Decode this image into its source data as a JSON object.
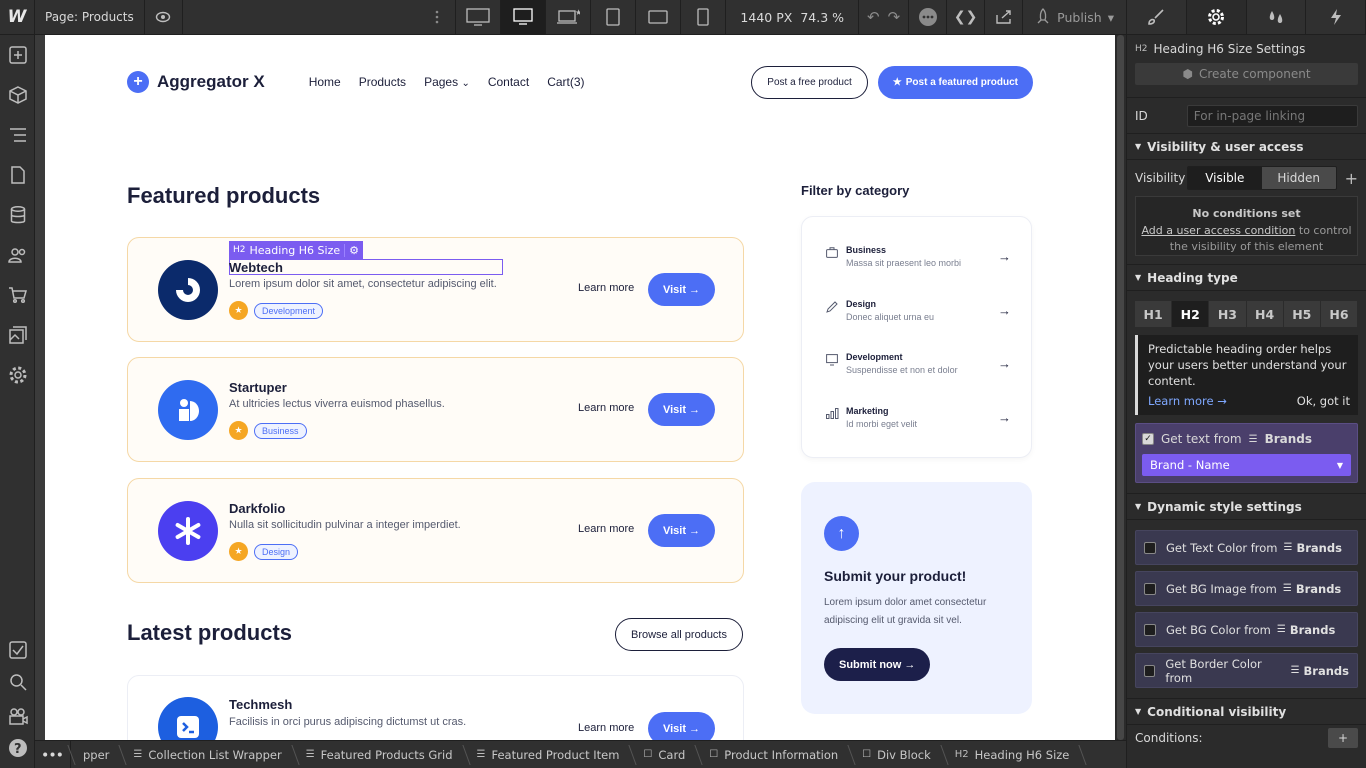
{
  "topbar": {
    "logo": "W",
    "page_selector": "Page: Products",
    "px_value": "1440 PX",
    "zoom": "74.3 %",
    "publish": "Publish",
    "publish_chevron": "▾",
    "devices": [
      "desktop-large-icon",
      "desktop-icon",
      "laptop-star-icon",
      "tablet-icon",
      "tablet-landscape-icon",
      "mobile-icon"
    ]
  },
  "site": {
    "brand": "Aggregator X",
    "nav": [
      "Home",
      "Products",
      "Pages",
      "Contact",
      "Cart(3)"
    ],
    "pages_chevron": "⌄",
    "post_free": "Post a free product",
    "post_featured": "Post a featured product",
    "featured_heading": "Featured products",
    "selection_tag": "Heading H6 Size",
    "selection_prefix": "H2",
    "cards": [
      {
        "title": "Webtech",
        "desc": "Lorem ipsum dolor sit amet, consectetur adipiscing elit.",
        "tag": "Development",
        "color": "#0b2a6b",
        "learn": "Learn more",
        "visit": "Visit →"
      },
      {
        "title": "Startuper",
        "desc": "At ultricies lectus viverra euismod phasellus.",
        "tag": "Business",
        "color": "#2f6bf0",
        "learn": "Learn more",
        "visit": "Visit →"
      },
      {
        "title": "Darkfolio",
        "desc": "Nulla sit sollicitudin pulvinar a integer imperdiet.",
        "tag": "Design",
        "color": "#4b3ff0",
        "learn": "Learn more",
        "visit": "Visit →"
      }
    ],
    "latest_heading": "Latest products",
    "browse": "Browse all products",
    "latest_card": {
      "title": "Techmesh",
      "desc": "Facilisis in orci purus adipiscing dictumst ut cras.",
      "learn": "Learn more",
      "visit": "Visit →"
    },
    "filter_heading": "Filter by category",
    "categories": [
      {
        "title": "Business",
        "sub": "Massa sit praesent leo morbi",
        "icon": "briefcase-icon"
      },
      {
        "title": "Design",
        "sub": "Donec aliquet urna eu",
        "icon": "pencil-icon"
      },
      {
        "title": "Development",
        "sub": "Suspendisse et non et dolor",
        "icon": "monitor-icon"
      },
      {
        "title": "Marketing",
        "sub": "Id morbi eget velit",
        "icon": "chart-icon"
      }
    ],
    "submit_title": "Submit your product!",
    "submit_desc": "Lorem ipsum dolor amet consectetur adipiscing elit ut gravida sit vel.",
    "submit_btn": "Submit now →"
  },
  "breadcrumb": {
    "more": "•••",
    "items": [
      "pper",
      "Collection List Wrapper",
      "Featured Products Grid",
      "Featured Product Item",
      "Card",
      "Product Information",
      "Div Block",
      "Heading H6 Size"
    ],
    "last_prefix": "H2"
  },
  "panel": {
    "title_prefix": "H2",
    "title": "Heading H6 Size Settings",
    "create_component": "Create component",
    "id_label": "ID",
    "id_placeholder": "For in-page linking",
    "visibility_section": "Visibility & user access",
    "visibility_label": "Visibility",
    "visible": "Visible",
    "hidden": "Hidden",
    "no_conditions": "No conditions set",
    "add_condition_link": "Add a user access condition",
    "add_condition_rest": " to control the visibility of this element",
    "heading_type_section": "Heading type",
    "heading_types": [
      "H1",
      "H2",
      "H3",
      "H4",
      "H5",
      "H6"
    ],
    "heading_selected": "H2",
    "note_text": "Predictable heading order helps your users better understand your content.",
    "learn_more": "Learn more →",
    "ok_got_it": "Ok, got it",
    "get_text_from": "Get text from",
    "brands": "Brands",
    "brand_select": "Brand - Name",
    "dynamic_section": "Dynamic style settings",
    "dynamic_rows": [
      "Get Text Color from",
      "Get BG Image from",
      "Get BG Color from",
      "Get Border Color from"
    ],
    "conditional_section": "Conditional visibility",
    "conditions_label": "Conditions:"
  }
}
